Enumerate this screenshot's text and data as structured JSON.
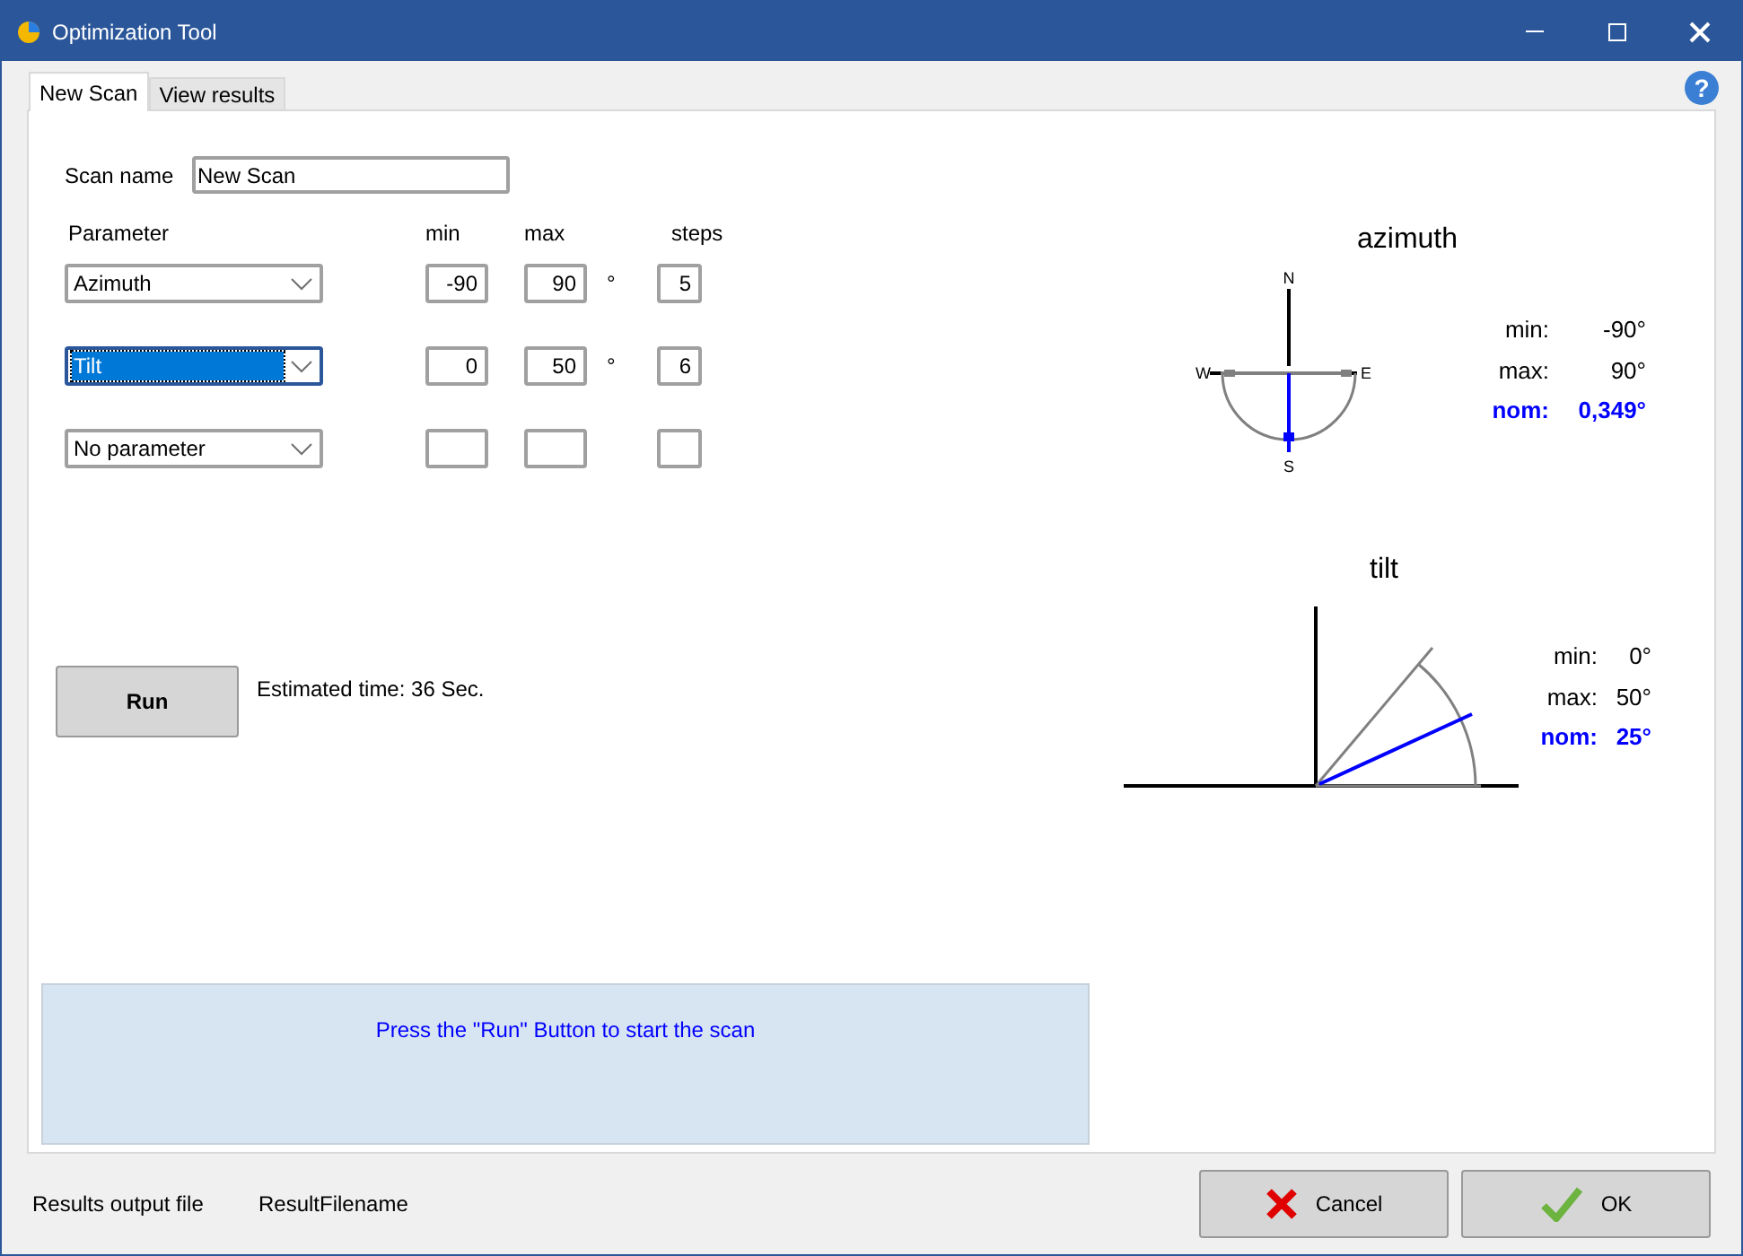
{
  "window": {
    "title": "Optimization Tool"
  },
  "help": "?",
  "tabs": [
    {
      "label": "New Scan",
      "selected": true
    },
    {
      "label": "View results",
      "selected": false
    }
  ],
  "scan_name": {
    "label": "Scan name",
    "value": "New Scan"
  },
  "headers": {
    "parameter": "Parameter",
    "min": "min",
    "max": "max",
    "steps": "steps"
  },
  "parameters": [
    {
      "value": "Azimuth",
      "min": "-90",
      "max": "90",
      "unit": "°",
      "steps": "5",
      "selected": false
    },
    {
      "value": "Tilt",
      "min": "0",
      "max": "50",
      "unit": "°",
      "steps": "6",
      "selected": true
    },
    {
      "value": "No parameter",
      "selected": false
    }
  ],
  "run_button": "Run",
  "estimate": "Estimated time: 36 Sec.",
  "message": "Press the \"Run\" Button to start the scan",
  "azimuth": {
    "title": "azimuth",
    "north": "N",
    "west": "W",
    "east": "E",
    "south": "S",
    "rows": [
      {
        "label": "min:",
        "value": "-90°",
        "kind": "limit"
      },
      {
        "label": "max:",
        "value": "90°",
        "kind": "limit"
      },
      {
        "label": "nom:",
        "value": "0,349°",
        "kind": "nominal"
      }
    ]
  },
  "tilt": {
    "title": "tilt",
    "rows": [
      {
        "label": "min:",
        "value": "0°",
        "kind": "limit"
      },
      {
        "label": "max:",
        "value": "50°",
        "kind": "limit"
      },
      {
        "label": "nom:",
        "value": "25°",
        "kind": "nominal"
      }
    ]
  },
  "output_file": {
    "label": "Results output file",
    "value": "ResultFilename"
  },
  "buttons": [
    {
      "label": "Cancel",
      "kind": "cancel"
    },
    {
      "label": "OK",
      "kind": "ok"
    }
  ]
}
